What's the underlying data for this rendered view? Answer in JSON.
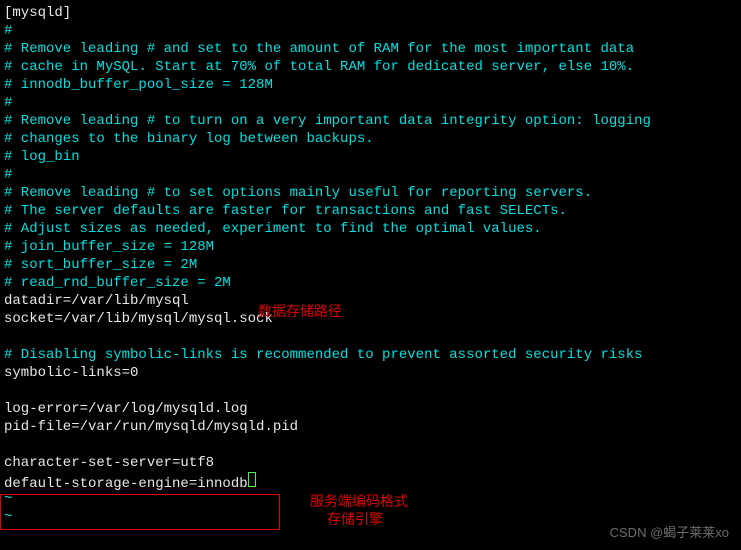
{
  "lines": [
    {
      "cls": "white",
      "text": "[mysqld]"
    },
    {
      "cls": "cyan",
      "text": "#"
    },
    {
      "cls": "cyan",
      "text": "# Remove leading # and set to the amount of RAM for the most important data"
    },
    {
      "cls": "cyan",
      "text": "# cache in MySQL. Start at 70% of total RAM for dedicated server, else 10%."
    },
    {
      "cls": "cyan",
      "text": "# innodb_buffer_pool_size = 128M"
    },
    {
      "cls": "cyan",
      "text": "#"
    },
    {
      "cls": "cyan",
      "text": "# Remove leading # to turn on a very important data integrity option: logging"
    },
    {
      "cls": "cyan",
      "text": "# changes to the binary log between backups."
    },
    {
      "cls": "cyan",
      "text": "# log_bin"
    },
    {
      "cls": "cyan",
      "text": "#"
    },
    {
      "cls": "cyan",
      "text": "# Remove leading # to set options mainly useful for reporting servers."
    },
    {
      "cls": "cyan",
      "text": "# The server defaults are faster for transactions and fast SELECTs."
    },
    {
      "cls": "cyan",
      "text": "# Adjust sizes as needed, experiment to find the optimal values."
    },
    {
      "cls": "cyan",
      "text": "# join_buffer_size = 128M"
    },
    {
      "cls": "cyan",
      "text": "# sort_buffer_size = 2M"
    },
    {
      "cls": "cyan",
      "text": "# read_rnd_buffer_size = 2M"
    },
    {
      "cls": "white",
      "text": "datadir=/var/lib/mysql"
    },
    {
      "cls": "white",
      "text": "socket=/var/lib/mysql/mysql.sock"
    },
    {
      "cls": "white",
      "text": ""
    },
    {
      "cls": "cyan",
      "text": "# Disabling symbolic-links is recommended to prevent assorted security risks"
    },
    {
      "cls": "white",
      "text": "symbolic-links=0"
    },
    {
      "cls": "white",
      "text": ""
    },
    {
      "cls": "white",
      "text": "log-error=/var/log/mysqld.log"
    },
    {
      "cls": "white",
      "text": "pid-file=/var/run/mysqld/mysqld.pid"
    },
    {
      "cls": "white",
      "text": ""
    },
    {
      "cls": "white",
      "text": "character-set-server=utf8"
    },
    {
      "cls": "white",
      "text": "default-storage-engine=innodb",
      "cursor": true
    },
    {
      "cls": "tilde",
      "text": "~"
    },
    {
      "cls": "tilde",
      "text": "~"
    }
  ],
  "annotations": {
    "a1": "数据存储路径",
    "a2": "服务端编码格式",
    "a3": "存储引擎"
  },
  "watermark": "CSDN @蝎子莱莱xo"
}
